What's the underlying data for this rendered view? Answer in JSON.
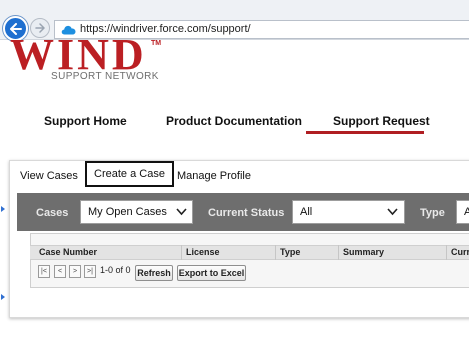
{
  "browser": {
    "url": "https://windriver.force.com/support/"
  },
  "logo": {
    "word": "WIND",
    "tm": "TM",
    "subtitle": "SUPPORT NETWORK"
  },
  "main_nav": {
    "items": [
      "Support Home",
      "Product Documentation",
      "Support Request"
    ],
    "active_index": 2
  },
  "sub_tabs": [
    "View Cases",
    "Create a Case",
    "Manage Profile"
  ],
  "filters": {
    "cases_label": "Cases",
    "cases_value": "My Open Cases",
    "status_label": "Current Status",
    "status_value": "All",
    "type_label": "Type",
    "type_value": "A"
  },
  "grid": {
    "columns": [
      "Case Number",
      "License",
      "Type",
      "Summary",
      "Curr"
    ],
    "pager": {
      "first": "|<",
      "prev": "<",
      "next": ">",
      "last": ">|",
      "range_text": "1-0 of 0"
    },
    "refresh_label": "Refresh",
    "export_label": "Export to Excel"
  },
  "colors": {
    "brand_red": "#bb1f23",
    "active_underline": "#b01e22",
    "filter_bar": "#6e6e6e",
    "back_button": "#1e6fd0"
  }
}
